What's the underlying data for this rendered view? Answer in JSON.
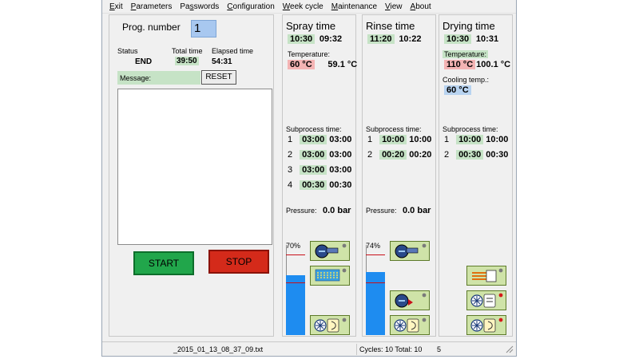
{
  "menu": [
    {
      "label": "Exit",
      "accel": "E",
      "rest": "xit"
    },
    {
      "label": "Parameters",
      "accel": "P",
      "rest": "arameters"
    },
    {
      "label": "Passwords",
      "pre": "Pa",
      "accel": "s",
      "rest": "swords"
    },
    {
      "label": "Configuration",
      "accel": "C",
      "rest": "onfiguration"
    },
    {
      "label": "Week cycle",
      "accel": "W",
      "rest": "eek cycle"
    },
    {
      "label": "Maintenance",
      "accel": "M",
      "rest": "aintenance"
    },
    {
      "label": "View",
      "accel": "V",
      "rest": "iew"
    },
    {
      "label": "About",
      "accel": "A",
      "rest": "bout"
    }
  ],
  "left": {
    "prog_label": "Prog. number",
    "prog_value": "1",
    "status_label": "Status",
    "status_value": "END",
    "total_label": "Total time",
    "total_value": "39:50",
    "elapsed_label": "Elapsed time",
    "elapsed_value": "54:31",
    "message_label": "Message:",
    "reset_label": "RESET",
    "start_label": "START",
    "stop_label": "STOP"
  },
  "spray": {
    "title": "Spray time",
    "time_set": "10:30",
    "time_act": "09:32",
    "temp_label": "Temperature:",
    "temp_set": "60 °C",
    "temp_act": "59.1 °C",
    "sub_label": "Subprocess time:",
    "sub_rows": [
      {
        "n": "1",
        "set": "03:00",
        "act": "03:00"
      },
      {
        "n": "2",
        "set": "03:00",
        "act": "03:00"
      },
      {
        "n": "3",
        "set": "03:00",
        "act": "03:00"
      },
      {
        "n": "4",
        "set": "00:30",
        "act": "00:30"
      }
    ],
    "pressure_label": "Pressure:",
    "pressure_value": "0.0 bar",
    "level_pct": "70%",
    "level_fraction": 0.66
  },
  "rinse": {
    "title": "Rinse time",
    "time_set": "11:20",
    "time_act": "10:22",
    "sub_label": "Subprocess time:",
    "sub_rows": [
      {
        "n": "1",
        "set": "10:00",
        "act": "10:00"
      },
      {
        "n": "2",
        "set": "00:20",
        "act": "00:20"
      }
    ],
    "pressure_label": "Pressure:",
    "pressure_value": "0.0 bar",
    "level_pct": "74%",
    "level_fraction": 0.7
  },
  "drying": {
    "title": "Drying time",
    "time_set": "10:30",
    "time_act": "10:31",
    "temp_label": "Temperature:",
    "temp_set": "110 °C",
    "temp_act": "100.1 °C",
    "cool_label": "Cooling temp.:",
    "cool_set": "60 °C",
    "sub_label": "Subprocess time:",
    "sub_rows": [
      {
        "n": "1",
        "set": "10:00",
        "act": "10:00"
      },
      {
        "n": "2",
        "set": "00:30",
        "act": "00:30"
      }
    ],
    "colors": {
      "temp_set_bg": "#f4b4b4",
      "cool_bg": "#b8d3f0"
    }
  },
  "statusbar": {
    "file": "_2015_01_13_08_37_09.txt",
    "cycles": "Cycles: 10 Total: 10",
    "count": "5"
  },
  "colors": {
    "start": "#21a64b",
    "stop": "#d42a1a",
    "value_bg": "#c6e3c6",
    "level": "#1e8cf0",
    "icon_bg": "#cfe3a8"
  }
}
